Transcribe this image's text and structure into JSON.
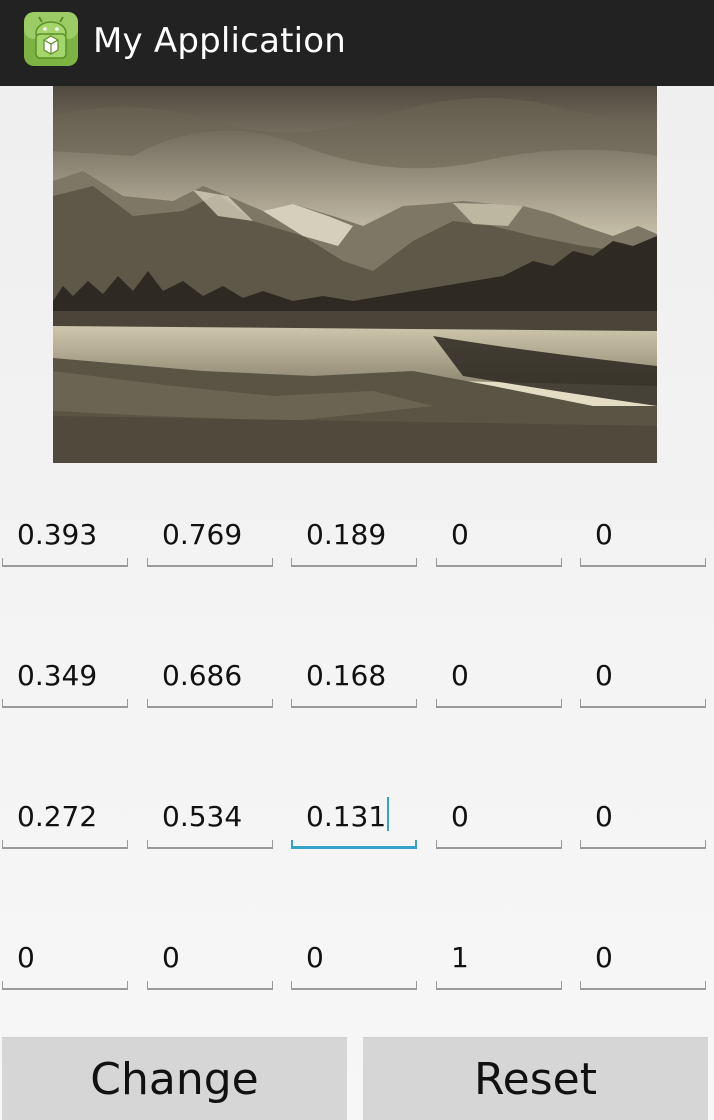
{
  "action_bar": {
    "title": "My Application",
    "icon": "android-app-icon"
  },
  "image": {
    "description_icon": "sepia-landscape-image"
  },
  "matrix": {
    "rows": [
      [
        "0.393",
        "0.769",
        "0.189",
        "0",
        "0"
      ],
      [
        "0.349",
        "0.686",
        "0.168",
        "0",
        "0"
      ],
      [
        "0.272",
        "0.534",
        "0.131",
        "0",
        "0"
      ],
      [
        "0",
        "0",
        "0",
        "1",
        "0"
      ]
    ],
    "focused_cell": "2.2"
  },
  "buttons": {
    "change_label": "Change",
    "reset_label": "Reset"
  },
  "colors": {
    "action_bar_bg": "#222222",
    "focus_accent": "#33a3c9",
    "button_bg": "#d6d6d6"
  }
}
